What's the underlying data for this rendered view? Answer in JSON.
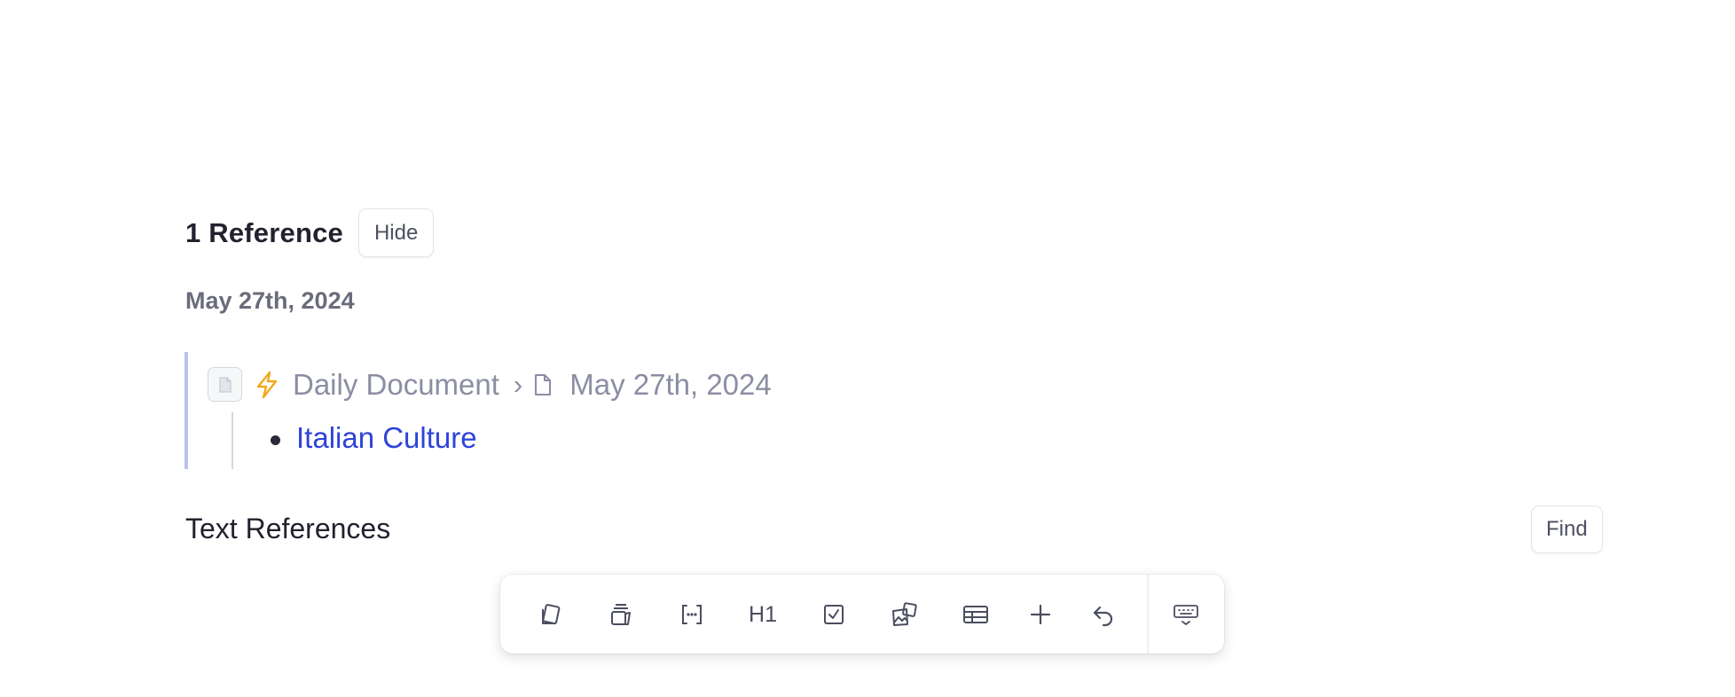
{
  "references": {
    "count_label": "1 Reference",
    "hide_label": "Hide",
    "date_heading": "May 27th, 2024",
    "item": {
      "path_root": "Daily Document",
      "path_separator": "›",
      "path_page": "May 27th, 2024",
      "link_text": "Italian Culture"
    },
    "text_references_label": "Text References",
    "find_label": "Find"
  },
  "toolbar": {
    "buttons": [
      {
        "name": "copy-icon"
      },
      {
        "name": "stack-icon"
      },
      {
        "name": "code-brackets-icon"
      },
      {
        "name": "heading-1",
        "label": "H1"
      },
      {
        "name": "checkbox-icon"
      },
      {
        "name": "image-icon"
      },
      {
        "name": "table-icon"
      },
      {
        "name": "plus-icon"
      },
      {
        "name": "undo-icon"
      },
      {
        "name": "keyboard-hide-icon"
      }
    ]
  },
  "colors": {
    "link": "#2d43d8",
    "muted_text": "#8b8ea3",
    "bolt": "#f2a81d",
    "card_border": "#b8c1f2"
  }
}
